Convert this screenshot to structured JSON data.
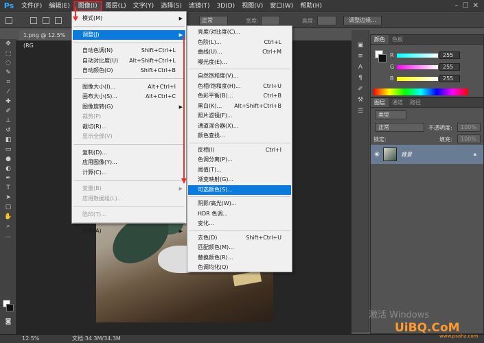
{
  "app": {
    "logo": "Ps",
    "menubar": [
      "文件(F)",
      "编辑(E)",
      "图像(I)",
      "图层(L)",
      "文字(Y)",
      "选择(S)",
      "滤镜(T)",
      "3D(D)",
      "视图(V)",
      "窗口(W)",
      "帮助(H)"
    ],
    "active_menu_index": 2,
    "window_controls": [
      "–",
      "☐",
      "✕"
    ]
  },
  "options_bar": {
    "style_value": "正常",
    "width_label": "宽度:",
    "height_label": "高度:",
    "refine_edge_button": "调整边缘..."
  },
  "document": {
    "tab_title": "1.png @ 12.5%(RG",
    "status_zoom": "12.5%",
    "status_doc": "文档:34.3M/34.3M"
  },
  "image_menu": {
    "items": [
      {
        "label": "模式(M)",
        "shortcut": "",
        "submenu": true,
        "disabled": false,
        "sep_before": false
      },
      {
        "label": "调整(J)",
        "shortcut": "",
        "submenu": true,
        "disabled": false,
        "sep_before": true,
        "highlight": true
      },
      {
        "label": "自动色调(N)",
        "shortcut": "Shift+Ctrl+L",
        "submenu": false,
        "disabled": false,
        "sep_before": true
      },
      {
        "label": "自动对比度(U)",
        "shortcut": "Alt+Shift+Ctrl+L",
        "submenu": false,
        "disabled": false,
        "sep_before": false
      },
      {
        "label": "自动颜色(O)",
        "shortcut": "Shift+Ctrl+B",
        "submenu": false,
        "disabled": false,
        "sep_before": false
      },
      {
        "label": "图像大小(I)...",
        "shortcut": "Alt+Ctrl+I",
        "submenu": false,
        "disabled": false,
        "sep_before": true
      },
      {
        "label": "画布大小(S)...",
        "shortcut": "Alt+Ctrl+C",
        "submenu": false,
        "disabled": false,
        "sep_before": false
      },
      {
        "label": "图像旋转(G)",
        "shortcut": "",
        "submenu": true,
        "disabled": false,
        "sep_before": false
      },
      {
        "label": "裁剪(P)",
        "shortcut": "",
        "submenu": false,
        "disabled": true,
        "sep_before": false
      },
      {
        "label": "裁切(R)...",
        "shortcut": "",
        "submenu": false,
        "disabled": false,
        "sep_before": false
      },
      {
        "label": "显示全部(V)",
        "shortcut": "",
        "submenu": false,
        "disabled": true,
        "sep_before": false
      },
      {
        "label": "复制(D)...",
        "shortcut": "",
        "submenu": false,
        "disabled": false,
        "sep_before": true
      },
      {
        "label": "应用图像(Y)...",
        "shortcut": "",
        "submenu": false,
        "disabled": false,
        "sep_before": false
      },
      {
        "label": "计算(C)...",
        "shortcut": "",
        "submenu": false,
        "disabled": false,
        "sep_before": false
      },
      {
        "label": "变量(B)",
        "shortcut": "",
        "submenu": true,
        "disabled": true,
        "sep_before": true
      },
      {
        "label": "应用数据组(L)...",
        "shortcut": "",
        "submenu": false,
        "disabled": true,
        "sep_before": false
      },
      {
        "label": "陷印(T)...",
        "shortcut": "",
        "submenu": false,
        "disabled": true,
        "sep_before": true
      },
      {
        "label": "分析(A)",
        "shortcut": "",
        "submenu": true,
        "disabled": false,
        "sep_before": true
      }
    ]
  },
  "adjust_menu": {
    "items": [
      {
        "label": "亮度/对比度(C)...",
        "shortcut": "",
        "sep_before": false
      },
      {
        "label": "色阶(L)...",
        "shortcut": "Ctrl+L",
        "sep_before": false
      },
      {
        "label": "曲线(U)...",
        "shortcut": "Ctrl+M",
        "sep_before": false
      },
      {
        "label": "曝光度(E)...",
        "shortcut": "",
        "sep_before": false
      },
      {
        "label": "自然饱和度(V)...",
        "shortcut": "",
        "sep_before": true
      },
      {
        "label": "色相/饱和度(H)...",
        "shortcut": "Ctrl+U",
        "sep_before": false
      },
      {
        "label": "色彩平衡(B)...",
        "shortcut": "Ctrl+B",
        "sep_before": false
      },
      {
        "label": "黑白(K)...",
        "shortcut": "Alt+Shift+Ctrl+B",
        "sep_before": false
      },
      {
        "label": "照片滤镜(F)...",
        "shortcut": "",
        "sep_before": false
      },
      {
        "label": "通道混合器(X)...",
        "shortcut": "",
        "sep_before": false
      },
      {
        "label": "颜色查找...",
        "shortcut": "",
        "sep_before": false
      },
      {
        "label": "反相(I)",
        "shortcut": "Ctrl+I",
        "sep_before": true
      },
      {
        "label": "色调分离(P)...",
        "shortcut": "",
        "sep_before": false
      },
      {
        "label": "阈值(T)...",
        "shortcut": "",
        "sep_before": false
      },
      {
        "label": "渐变映射(G)...",
        "shortcut": "",
        "sep_before": false
      },
      {
        "label": "可选颜色(S)...",
        "shortcut": "",
        "sep_before": false,
        "highlight": true
      },
      {
        "label": "阴影/高光(W)...",
        "shortcut": "",
        "sep_before": true
      },
      {
        "label": "HDR 色调...",
        "shortcut": "",
        "sep_before": false
      },
      {
        "label": "变化...",
        "shortcut": "",
        "sep_before": false
      },
      {
        "label": "去色(D)",
        "shortcut": "Shift+Ctrl+U",
        "sep_before": true
      },
      {
        "label": "匹配颜色(M)...",
        "shortcut": "",
        "sep_before": false
      },
      {
        "label": "替换颜色(R)...",
        "shortcut": "",
        "sep_before": false
      },
      {
        "label": "色调均化(Q)",
        "shortcut": "",
        "sep_before": false
      }
    ]
  },
  "color_panel": {
    "tabs": [
      "颜色",
      "色板"
    ],
    "channels": [
      {
        "label": "R",
        "value": "255",
        "gradient": "linear-gradient(90deg,#00ffff,#ffffff)"
      },
      {
        "label": "G",
        "value": "255",
        "gradient": "linear-gradient(90deg,#ff00ff,#ffffff)"
      },
      {
        "label": "B",
        "value": "255",
        "gradient": "linear-gradient(90deg,#ffff00,#ffffff)"
      }
    ]
  },
  "layers_panel": {
    "tabs": [
      "图层",
      "通道",
      "路径"
    ],
    "kind_filter": "类型",
    "blend_mode": "正常",
    "opacity_label": "不透明度:",
    "opacity_value": "100%",
    "lock_label": "锁定:",
    "fill_label": "填充:",
    "fill_value": "100%",
    "layer_name": "背景"
  },
  "watermark": {
    "activate": "激活 Windows",
    "brand": "UiBQ.CoM",
    "site": "www.psahz.com"
  },
  "colors": {
    "menu_highlight": "#0a7bdc",
    "annotation_red": "#e8332a",
    "layer_selected": "#6a7c93"
  }
}
